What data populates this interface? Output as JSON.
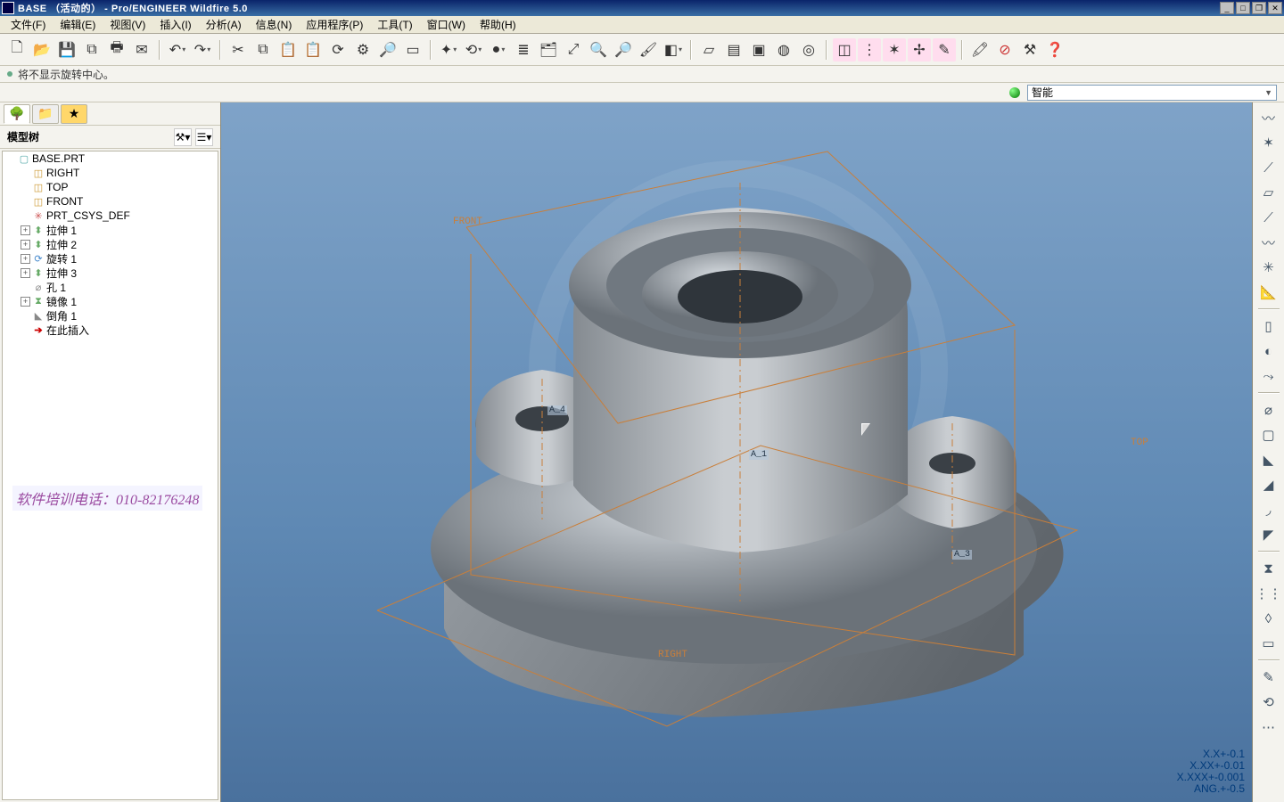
{
  "title": "BASE （活动的） - Pro/ENGINEER Wildfire 5.0",
  "menu": [
    "文件(F)",
    "编辑(E)",
    "视图(V)",
    "插入(I)",
    "分析(A)",
    "信息(N)",
    "应用程序(P)",
    "工具(T)",
    "窗口(W)",
    "帮助(H)"
  ],
  "msg": "将不显示旋转中心。",
  "filter_label": "智能",
  "left": {
    "model_tree_label": "模型树",
    "nodes": [
      {
        "d": 0,
        "exp": "",
        "icon": "part",
        "label": "BASE.PRT"
      },
      {
        "d": 1,
        "exp": "",
        "icon": "datum",
        "label": "RIGHT"
      },
      {
        "d": 1,
        "exp": "",
        "icon": "datum",
        "label": "TOP"
      },
      {
        "d": 1,
        "exp": "",
        "icon": "datum",
        "label": "FRONT"
      },
      {
        "d": 1,
        "exp": "",
        "icon": "csys",
        "label": "PRT_CSYS_DEF"
      },
      {
        "d": 1,
        "exp": "+",
        "icon": "feat",
        "label": "拉伸 1"
      },
      {
        "d": 1,
        "exp": "+",
        "icon": "feat",
        "label": "拉伸 2"
      },
      {
        "d": 1,
        "exp": "+",
        "icon": "rev",
        "label": "旋转 1"
      },
      {
        "d": 1,
        "exp": "+",
        "icon": "feat",
        "label": "拉伸 3"
      },
      {
        "d": 1,
        "exp": "",
        "icon": "hole",
        "label": "孔 1"
      },
      {
        "d": 1,
        "exp": "+",
        "icon": "mir",
        "label": "镜像 1"
      },
      {
        "d": 1,
        "exp": "",
        "icon": "cham",
        "label": "倒角 1"
      },
      {
        "d": 1,
        "exp": "",
        "icon": "ins",
        "label": "在此插入"
      }
    ]
  },
  "watermark": "软件培训电话：010-82176248",
  "datum_labels": {
    "front": "FRONT",
    "top": "TOP",
    "right": "RIGHT"
  },
  "axis_labels": {
    "a1": "A_1",
    "a3": "A_3",
    "a4": "A_4"
  },
  "precision": [
    "X.X+-0.1",
    "X.XX+-0.01",
    "X.XXX+-0.001",
    "ANG.+-0.5"
  ]
}
